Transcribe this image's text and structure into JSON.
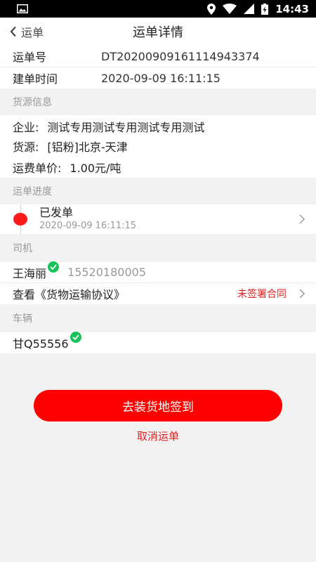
{
  "status_bar": {
    "time": "14:43"
  },
  "nav": {
    "back_label": "运单",
    "title": "运单详情"
  },
  "order": {
    "number_key": "运单号",
    "number_value": "DT20200909161114943374",
    "created_key": "建单时间",
    "created_value": "2020-09-09 16:11:15"
  },
  "cargo": {
    "section_title": "货源信息",
    "company_key": "企业:",
    "company_value": "测试专用测试专用测试专用测试",
    "source_key": "货源:",
    "source_value": "[铝粉]北京-天津",
    "price_key": "运费单价:",
    "price_value": "1.00元/吨"
  },
  "progress": {
    "section_title": "运单进度",
    "status": "已发单",
    "time": "2020-09-09 16:11:15"
  },
  "driver": {
    "section_title": "司机",
    "name": "王海丽",
    "phone": "15520180005",
    "verified_icon": "check-circle-icon",
    "contract_label": "查看《货物运输协议》",
    "contract_status": "未签署合同"
  },
  "vehicle": {
    "section_title": "车辆",
    "plate": "甘Q55556",
    "verified_icon": "check-circle-icon"
  },
  "actions": {
    "primary_label": "去装货地签到",
    "cancel_label": "取消运单"
  },
  "colors": {
    "accent": "#ff0000",
    "verified": "#18c25a",
    "muted": "#999999"
  }
}
